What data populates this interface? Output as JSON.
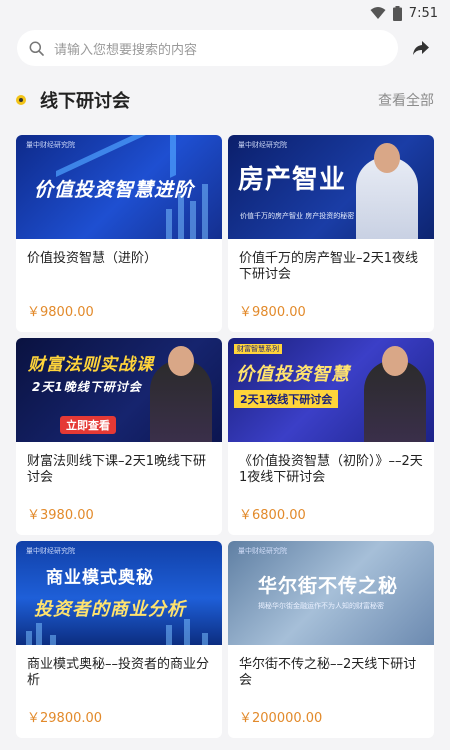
{
  "status": {
    "time": "7:51"
  },
  "search": {
    "placeholder": "请输入您想要搜索的内容"
  },
  "section": {
    "title": "线下研讨会",
    "view_all": "查看全部"
  },
  "cards": [
    {
      "title": "价值投资智慧（进阶）",
      "price": "￥9800.00",
      "thumb": {
        "logo": "量中财经研究院",
        "big": "价值投资智慧进阶"
      }
    },
    {
      "title": "价值千万的房产智业–2天1夜线下研讨会",
      "price": "￥9800.00",
      "thumb": {
        "logo": "量中财经研究院",
        "big": "房产智业",
        "small": "价值千万的房产智业 房产投资的秘密"
      }
    },
    {
      "title": "财富法则线下课–2天1晚线下研讨会",
      "price": "￥3980.00",
      "thumb": {
        "big": "财富法则实战课",
        "sub": "2天1晚线下研讨会",
        "button": "立即查看"
      }
    },
    {
      "title": "《价值投资智慧（初阶）》––2天1夜线下研讨会",
      "price": "￥6800.00",
      "thumb": {
        "tag": "财富智慧系列",
        "big": "价值投资智慧",
        "sub": "2天1夜线下研讨会"
      }
    },
    {
      "title": "商业模式奥秘––投资者的商业分析",
      "price": "￥29800.00",
      "thumb": {
        "logo": "量中财经研究院",
        "big": "商业模式奥秘",
        "sub": "投资者的商业分析"
      }
    },
    {
      "title": "华尔街不传之秘––2天线下研讨会",
      "price": "￥200000.00",
      "thumb": {
        "logo": "量中财经研究院",
        "big": "华尔街不传之秘",
        "small": "揭秘华尔街金融运作不为人知的财富秘密"
      }
    }
  ],
  "colors": {
    "accent_yellow": "#f2c318",
    "price": "#e28a2b"
  },
  "icons": [
    "wifi-icon",
    "battery-icon",
    "search-icon",
    "share-icon"
  ]
}
